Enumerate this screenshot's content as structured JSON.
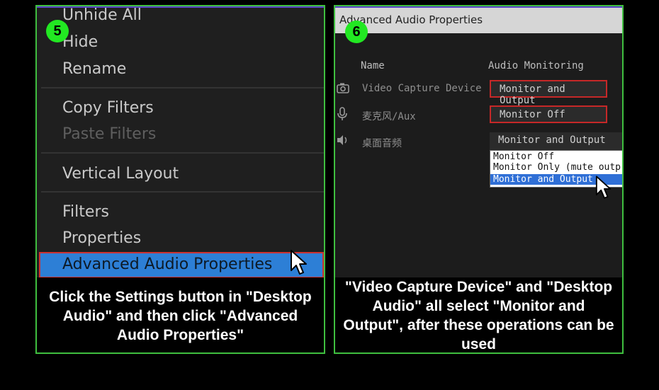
{
  "left": {
    "badge": "5",
    "menu": {
      "unhide_all": "Unhide All",
      "hide": "Hide",
      "rename": "Rename",
      "copy_filters": "Copy Filters",
      "paste_filters": "Paste Filters",
      "vertical_layout": "Vertical Layout",
      "filters": "Filters",
      "properties": "Properties",
      "advanced_audio_properties": "Advanced Audio Properties"
    },
    "caption": "Click the Settings button in \"Desktop Audio\" and then click \"Advanced Audio Properties\""
  },
  "right": {
    "badge": "6",
    "dialog_title": "Advanced Audio Properties",
    "columns": {
      "name": "Name",
      "audio_monitoring": "Audio Monitoring"
    },
    "rows": [
      {
        "name": "Video Capture Device",
        "monitoring": "Monitor and Output"
      },
      {
        "name": "麦克风/Aux",
        "monitoring": "Monitor Off"
      },
      {
        "name": "桌面音频",
        "monitoring": "Monitor and Output"
      }
    ],
    "dropdown_options": [
      "Monitor Off",
      "Monitor Only (mute outp",
      "Monitor and Output"
    ],
    "caption": "\"Video Capture Device\" and \"Desktop Audio\" all select \"Monitor and Output\", after these operations can be used"
  },
  "colors": {
    "frame": "#3fbf3f",
    "badge": "#22e822",
    "highlight": "#2d7fd6",
    "outline": "#c62828"
  },
  "icons": [
    "camera-icon",
    "microphone-icon",
    "speaker-icon",
    "mouse-cursor-icon"
  ]
}
